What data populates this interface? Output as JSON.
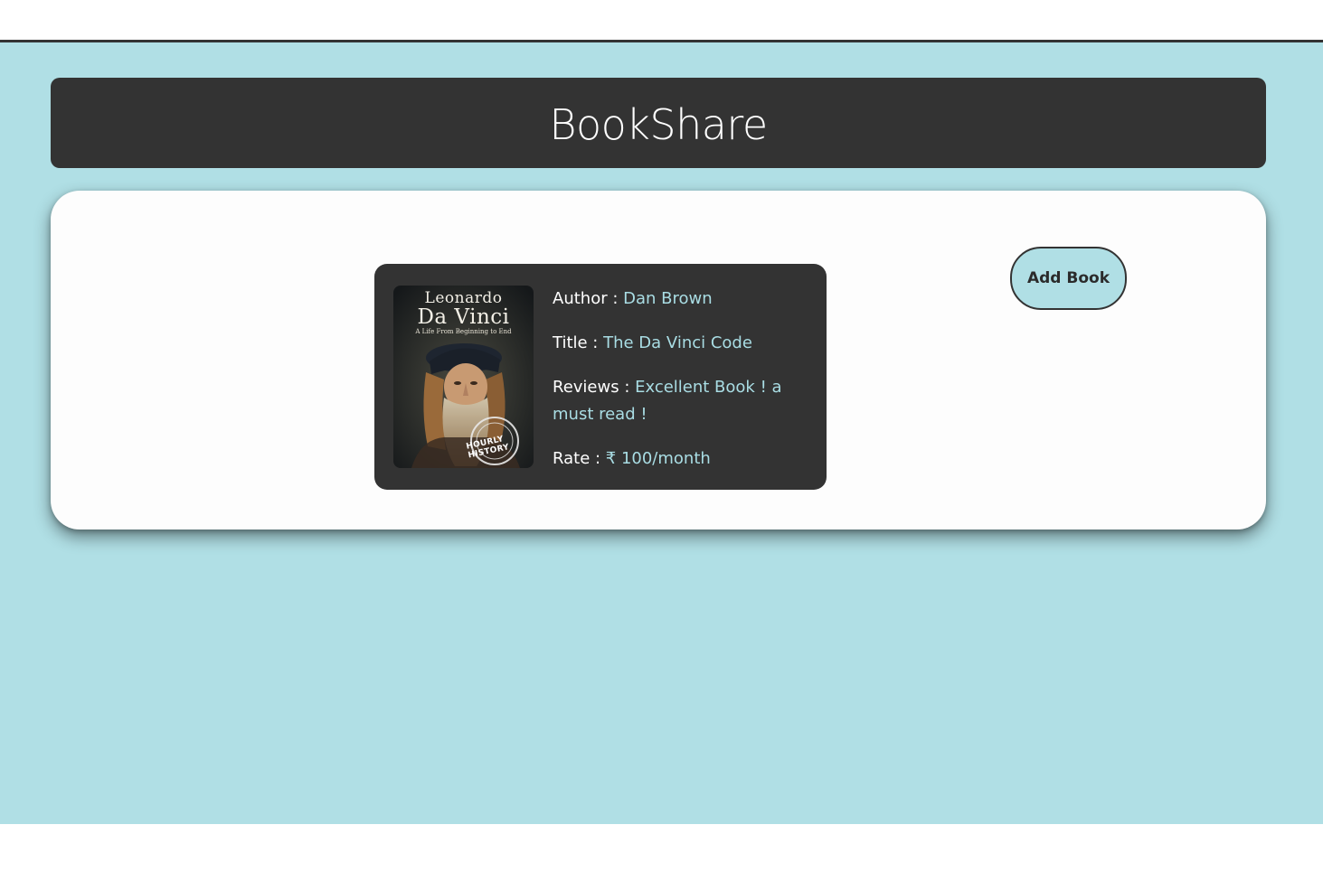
{
  "header": {
    "title": "BookShare"
  },
  "book": {
    "cover": {
      "title_line1": "Leonardo",
      "title_line2": "Da Vinci",
      "subtitle": "A Life From Beginning to End",
      "stamp": "HOURLY HISTORY"
    },
    "author_label": "Author : ",
    "author": "Dan Brown",
    "title_label": "Title : ",
    "title": "The Da Vinci Code",
    "reviews_label": "Reviews : ",
    "reviews": "Excellent Book ! a must read !",
    "rate_label": "Rate : ",
    "rate": "₹ 100/month"
  },
  "actions": {
    "add_book_label": "Add Book"
  },
  "colors": {
    "page_background": "#b0dfe5",
    "header_background": "#333333",
    "card_background": "#333333",
    "value_text": "#a9dde4",
    "panel_background": "#fdfdfd"
  }
}
